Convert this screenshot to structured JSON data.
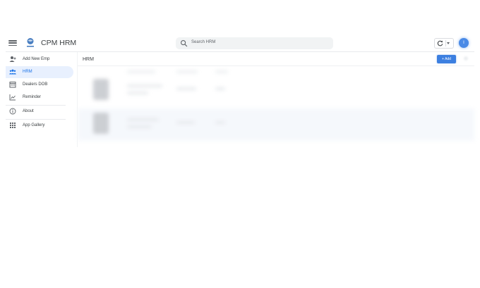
{
  "header": {
    "app_title": "CPM HRM",
    "search_placeholder": "Search HRM",
    "avatar_initial": "I",
    "brand_color": "#1a73e8",
    "avatar_color": "#4a8ae6"
  },
  "sidebar": {
    "items": [
      {
        "label": "Add New Emp",
        "icon": "person-add-icon",
        "active": false
      },
      {
        "label": "HRM",
        "icon": "people-icon",
        "active": true
      },
      {
        "label": "Dealers DOB",
        "icon": "calendar-icon",
        "active": false
      },
      {
        "label": "Reminder",
        "icon": "chart-icon",
        "active": false
      },
      {
        "label": "About",
        "icon": "info-icon",
        "active": false
      },
      {
        "label": "App Gallery",
        "icon": "grid-icon",
        "active": false
      }
    ]
  },
  "main": {
    "title": "HRM",
    "add_label": "+ Add"
  }
}
